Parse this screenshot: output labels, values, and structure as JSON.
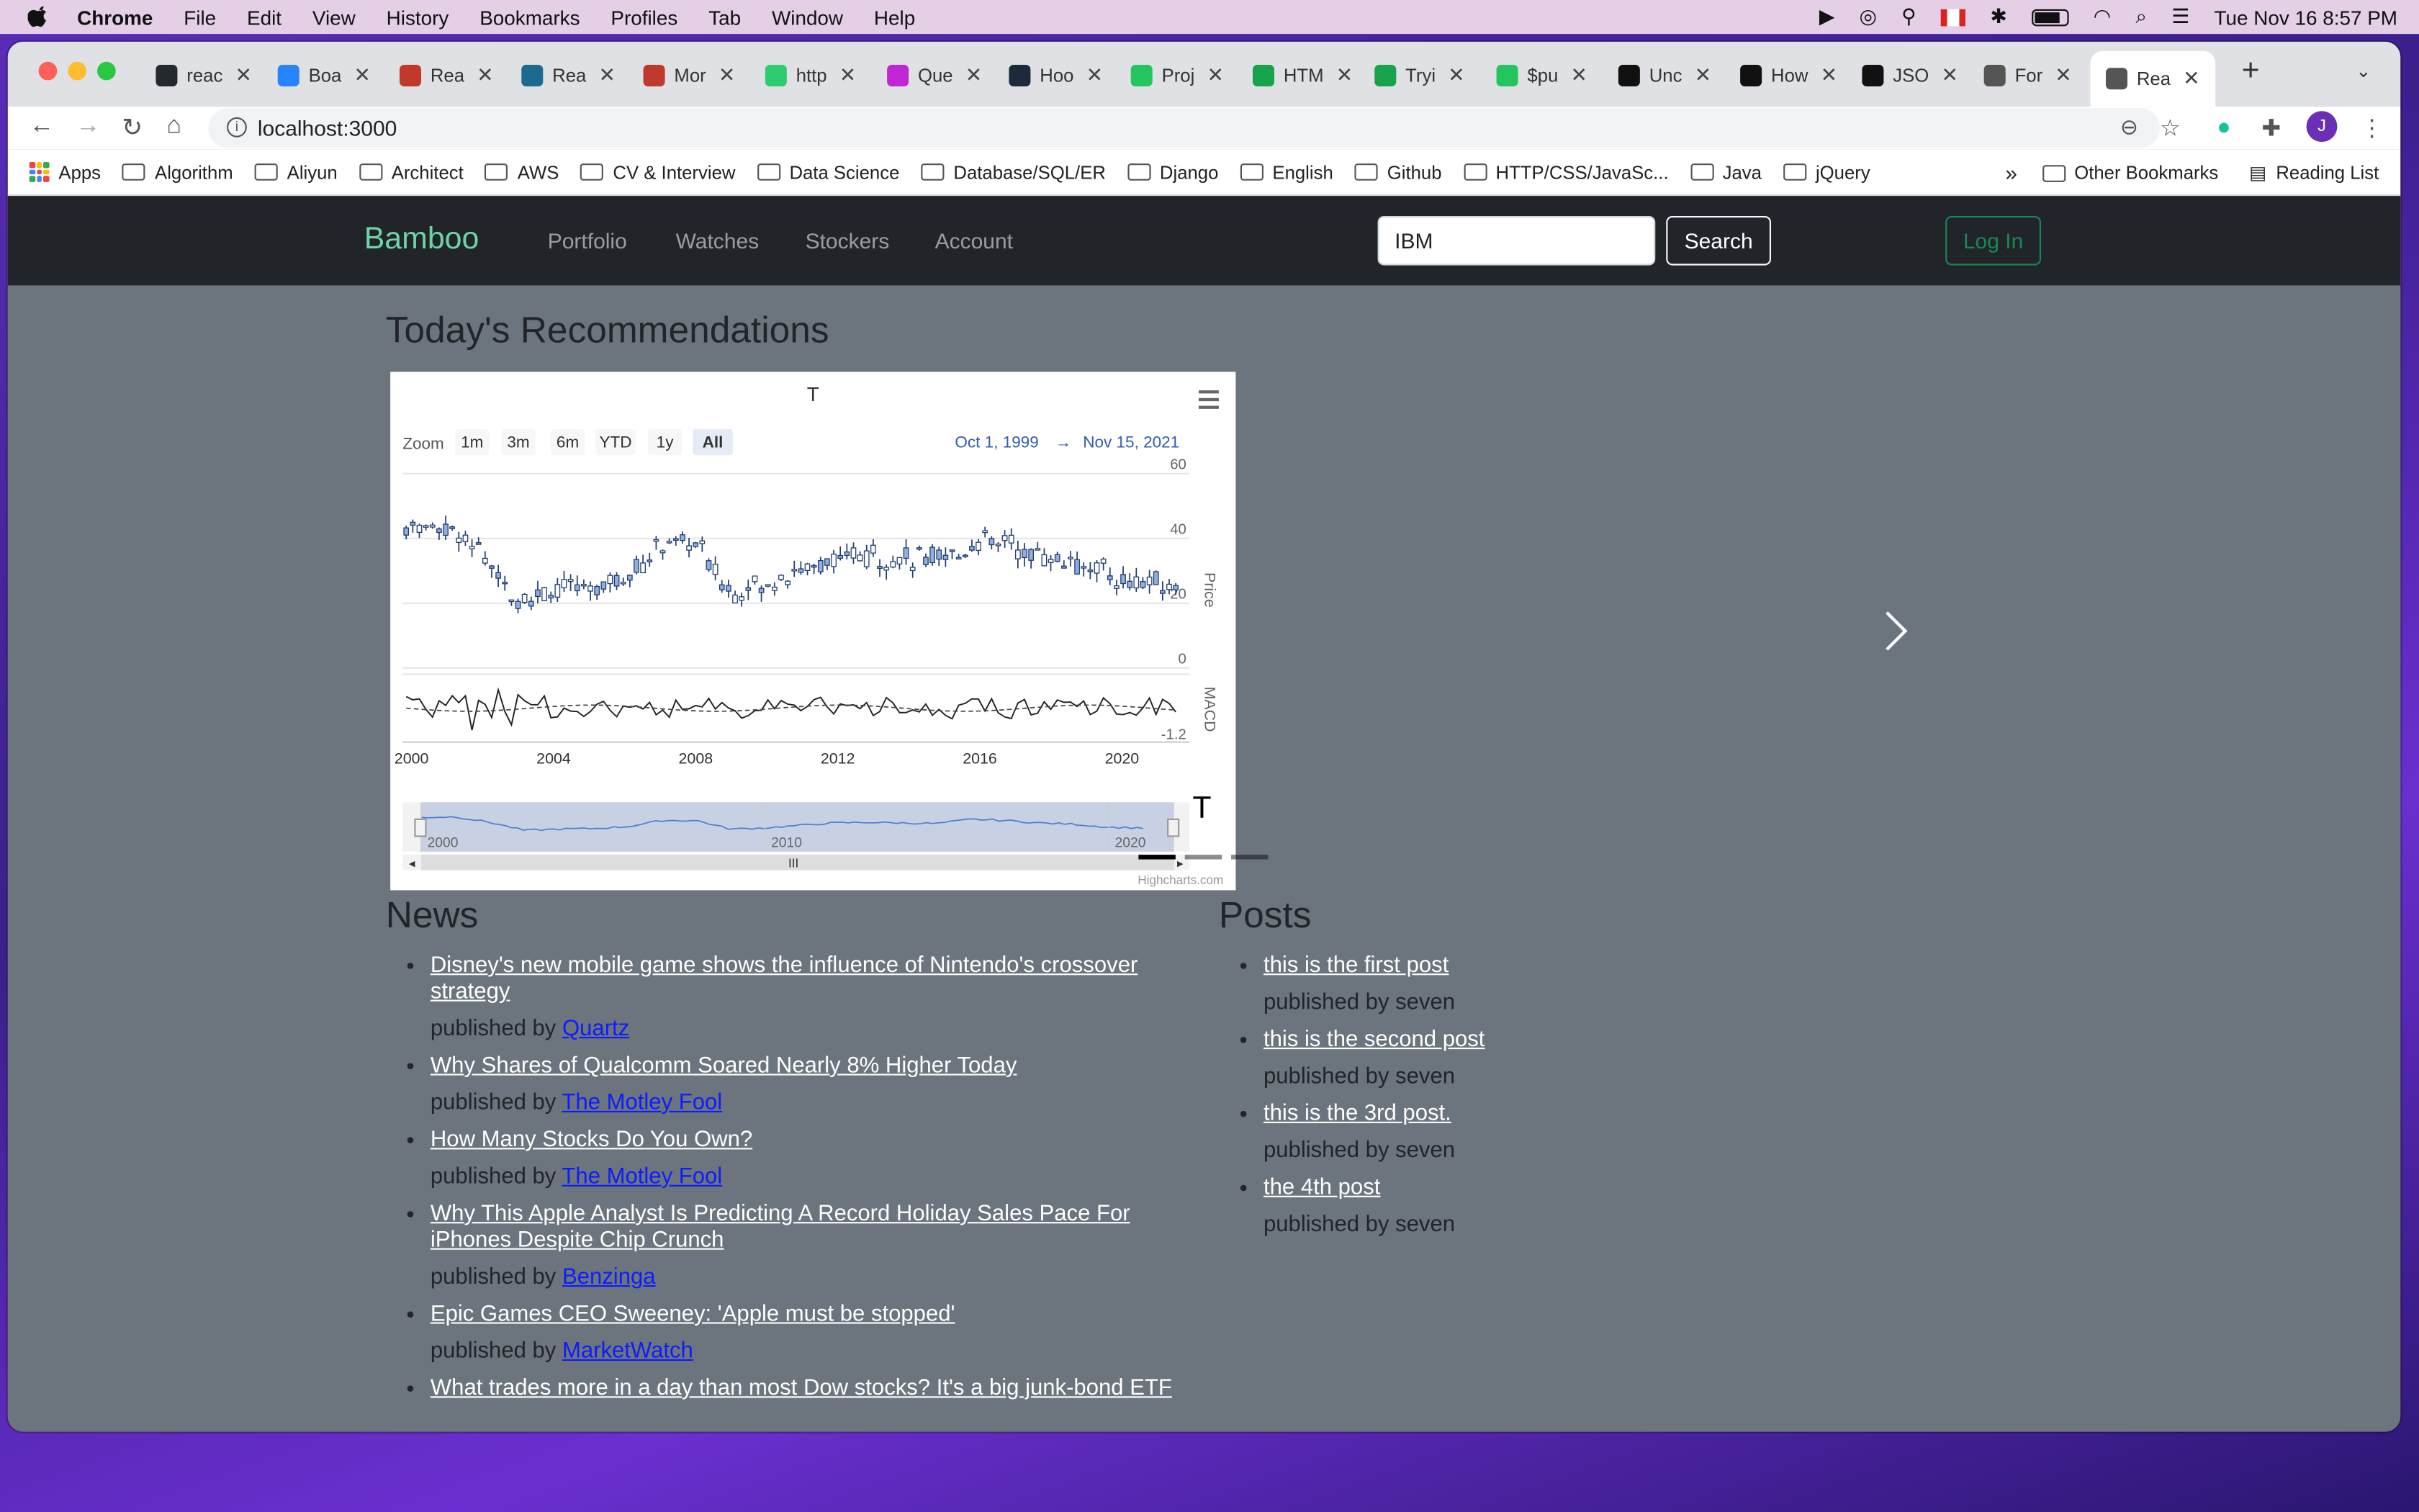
{
  "menubar": {
    "app": "Chrome",
    "items": [
      "File",
      "Edit",
      "View",
      "History",
      "Bookmarks",
      "Profiles",
      "Tab",
      "Window",
      "Help"
    ],
    "datetime": "Tue Nov 16  8:57 PM"
  },
  "tabs": [
    {
      "label": "reac",
      "color": "#24292e"
    },
    {
      "label": "Boa",
      "color": "#2684ff"
    },
    {
      "label": "Rea",
      "color": "#c0392b"
    },
    {
      "label": "Rea",
      "color": "#1b6b8f"
    },
    {
      "label": "Mor",
      "color": "#c0392b"
    },
    {
      "label": "http",
      "color": "#2ecc71"
    },
    {
      "label": "Que",
      "color": "#c026d3"
    },
    {
      "label": "Hoo",
      "color": "#1e293b"
    },
    {
      "label": "Proj",
      "color": "#22c55e"
    },
    {
      "label": "HTM",
      "color": "#16a34a"
    },
    {
      "label": "Tryi",
      "color": "#16a34a"
    },
    {
      "label": "$pu",
      "color": "#22c55e"
    },
    {
      "label": "Unc",
      "color": "#111"
    },
    {
      "label": "How",
      "color": "#111"
    },
    {
      "label": "JSO",
      "color": "#111"
    },
    {
      "label": "For",
      "color": "#555"
    },
    {
      "label": "Rea",
      "color": "#555",
      "active": true
    }
  ],
  "address": {
    "url": "localhost:3000"
  },
  "profile_initial": "J",
  "bookmarks": [
    "Algorithm",
    "Aliyun",
    "Architect",
    "AWS",
    "CV & Interview",
    "Data Science",
    "Database/SQL/ER",
    "Django",
    "English",
    "Github",
    "HTTP/CSS/JavaSc...",
    "Java",
    "jQuery"
  ],
  "bookmarks_apps": "Apps",
  "bookmarks_more": "»",
  "bookmarks_other": "Other Bookmarks",
  "bookmarks_reading": "Reading List",
  "nav": {
    "brand": "Bamboo",
    "links": [
      "Portfolio",
      "Watches",
      "Stockers",
      "Account"
    ],
    "search_value": "IBM",
    "search_label": "Search",
    "login_label": "Log In"
  },
  "recommend_title": "Today's Recommendations",
  "chart": {
    "title": "T",
    "zoom_label": "Zoom",
    "zoom_buttons": [
      "1m",
      "3m",
      "6m",
      "YTD",
      "1y",
      "All"
    ],
    "selected_zoom": "All",
    "range_from": "Oct 1, 1999",
    "range_arrow": "→",
    "range_to": "Nov 15, 2021",
    "price_axis_label": "Price",
    "macd_axis_label": "MACD",
    "price_ticks": [
      "60",
      "40",
      "20",
      "0"
    ],
    "macd_ticks": [
      "-1.2"
    ],
    "x_ticks": [
      "2000",
      "2004",
      "2008",
      "2012",
      "2016",
      "2020"
    ],
    "navigator_ticks": [
      "2000",
      "2010",
      "2020"
    ],
    "credits": "Highcharts.com",
    "slide_caption": "T"
  },
  "chart_data": {
    "type": "line",
    "title": "T",
    "x": [
      2000,
      2001,
      2002,
      2003,
      2004,
      2005,
      2006,
      2007,
      2008,
      2009,
      2010,
      2011,
      2012,
      2013,
      2014,
      2015,
      2016,
      2017,
      2018,
      2019,
      2020,
      2021
    ],
    "series": [
      {
        "name": "Price",
        "values": [
          43,
          44,
          35,
          22,
          24,
          25,
          28,
          38,
          38,
          24,
          26,
          30,
          34,
          35,
          34,
          33,
          40,
          38,
          34,
          32,
          27,
          26
        ]
      }
    ],
    "ylabel": "Price",
    "ylim": [
      0,
      60
    ],
    "macd_ylabel": "MACD"
  },
  "news_title": "News",
  "news": [
    {
      "title": "Disney's new mobile game shows the influence of Nintendo's crossover strategy",
      "publisher": "Quartz"
    },
    {
      "title": "Why Shares of Qualcomm Soared Nearly 8% Higher Today",
      "publisher": "The Motley Fool"
    },
    {
      "title": "How Many Stocks Do You Own?",
      "publisher": "The Motley Fool"
    },
    {
      "title": "Why This Apple Analyst Is Predicting A Record Holiday Sales Pace For iPhones Despite Chip Crunch",
      "publisher": "Benzinga"
    },
    {
      "title": "Epic Games CEO Sweeney: 'Apple must be stopped'",
      "publisher": "MarketWatch"
    },
    {
      "title": "What trades more in a day than most Dow stocks? It's a big junk-bond ETF",
      "publisher": ""
    }
  ],
  "posts_title": "Posts",
  "posts": [
    {
      "title": "this is the first post",
      "author": "seven"
    },
    {
      "title": "this is the second post",
      "author": "seven"
    },
    {
      "title": "this is the 3rd post.",
      "author": "seven"
    },
    {
      "title": "the 4th post",
      "author": "seven"
    }
  ],
  "published_by": "published by"
}
